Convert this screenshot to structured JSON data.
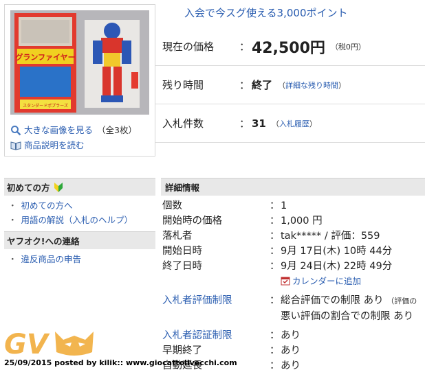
{
  "promo": {
    "text": "入会で今スグ使える3,000ポイント"
  },
  "thumb": {
    "box_text": "グランファイヤー",
    "box_brand": "スタンダードポプラーズ",
    "large_image_link": "大きな画像を見る",
    "image_count": "（全3枚）",
    "description_link": "商品説明を読む"
  },
  "summary": {
    "price_label": "現在の価格",
    "colon": "：",
    "price_value": "42,500円",
    "price_tax": "（税0円）",
    "time_label": "残り時間",
    "time_value": "終了",
    "time_note_open": "（",
    "time_note_link": "詳細な残り時間",
    "time_note_close": "）",
    "bids_label": "入札件数",
    "bids_value": "31",
    "bids_note_open": "（",
    "bids_note_link": "入札履歴",
    "bids_note_close": "）"
  },
  "sidebar": {
    "section1_title": "初めての方",
    "section1_items": [
      "初めての方へ",
      "用語の解説（入札のヘルプ）"
    ],
    "section2_title": "ヤフオク!への連絡",
    "section2_items": [
      "違反商品の申告"
    ],
    "bullet": "・"
  },
  "detail": {
    "title": "詳細情報",
    "colon": "：",
    "rows": [
      {
        "label": "個数",
        "value": "1"
      },
      {
        "label": "開始時の価格",
        "value": "1,000 円"
      },
      {
        "label": "落札者",
        "value": "tak***** / 評価：559"
      },
      {
        "label": "開始日時",
        "value": "9月 17日(木) 10時 44分"
      },
      {
        "label": "終了日時",
        "value": "9月 24日(木) 22時 49分"
      }
    ],
    "calendar_link": "カレンダーに追加",
    "restriction_label": "入札者評価制限",
    "restriction_value1": "総合評価での制限 あり",
    "restriction_value1_note": "（評価の",
    "restriction_value2": "悪い評価の割合での制限 あり",
    "auth_label": "入札者認証制限",
    "auth_value": "あり",
    "early_label": "早期終了",
    "early_value": "あり",
    "auto_label": "自動延長",
    "auto_value": "あり"
  },
  "watermark": {
    "letters": "GV"
  },
  "credit": {
    "text": "25/09/2015 posted by kilik:: www.giocattolivecchi.com"
  },
  "colors": {
    "link": "#2a5db0",
    "section_bg": "#e8e8e8",
    "watermark": "#f0a830"
  }
}
